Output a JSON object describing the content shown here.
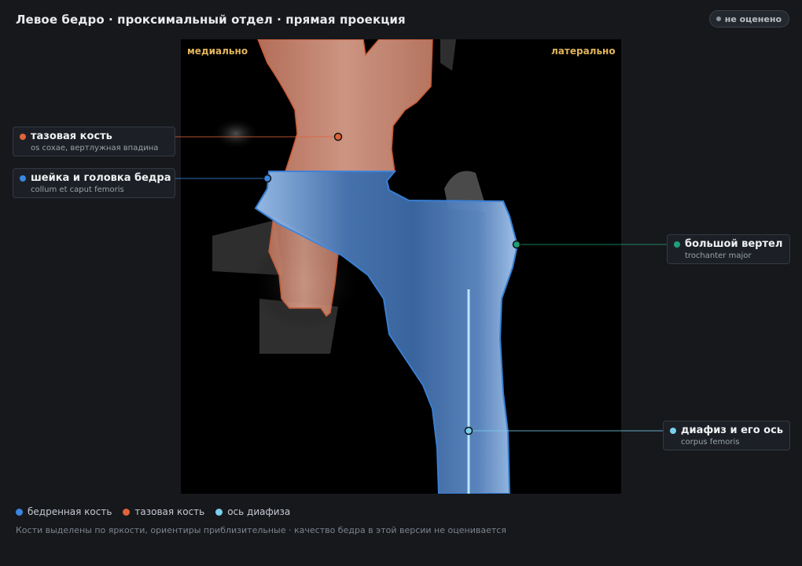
{
  "header": {
    "title": "Левое бедро · проксимальный отдел · прямая проекция",
    "status_badge": "не оценено"
  },
  "image": {
    "orientation_left": "медиально",
    "orientation_right": "латерально"
  },
  "callouts": [
    {
      "id": "pelvis",
      "label": "тазовая кость",
      "sublabel": "os coxae, вертлужная впадина",
      "color": "#e0633a"
    },
    {
      "id": "neck",
      "label": "шейка и головка бедра",
      "sublabel": "collum et caput femoris",
      "color": "#3b86e0"
    },
    {
      "id": "trochanter",
      "label": "большой вертел",
      "sublabel": "trochanter major",
      "color": "#1f9e78"
    },
    {
      "id": "shaft",
      "label": "диафиз и его ось",
      "sublabel": "corpus femoris",
      "color": "#78d0ee"
    }
  ],
  "legend": [
    {
      "label": "бедренная кость",
      "color": "#3b86e0"
    },
    {
      "label": "тазовая кость",
      "color": "#e0633a"
    },
    {
      "label": "ось диафиза",
      "color": "#78d0ee"
    }
  ],
  "footnote": "Кости выделены по яркости, ориентиры приблизительные · качество бедра в этой версии не оценивается"
}
